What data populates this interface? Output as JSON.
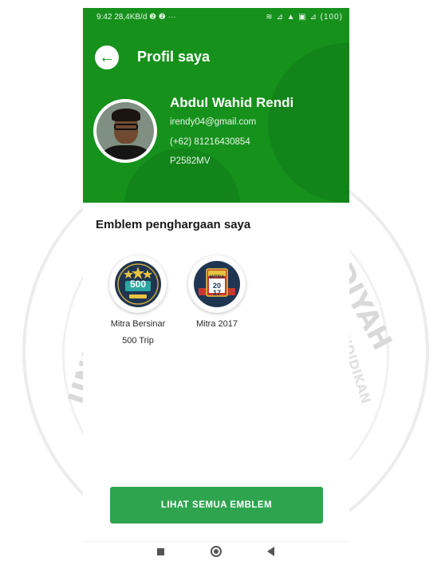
{
  "status_bar": {
    "left": "9:42  28,4KB/d ❷ ❷ ···",
    "right": "≋ ⊿ ▲ ▣ ⊿ (100)"
  },
  "header": {
    "title": "Profil saya",
    "back_icon": "arrow-left-icon"
  },
  "profile": {
    "name": "Abdul Wahid Rendi",
    "email": "irendy04@gmail.com",
    "phone": "(+62) 81216430854",
    "code": "P2582MV"
  },
  "emblems": {
    "title": "Emblem penghargaan saya",
    "items": [
      {
        "label_line1": "Mitra Bersinar",
        "label_line2": "500 Trip",
        "badge_text": "500",
        "icon": "stars-500-badge-icon"
      },
      {
        "label_line1": "Mitra 2017",
        "label_line2": "",
        "badge_top": "MITRA",
        "badge_num_top": "20",
        "badge_num_bottom": "17",
        "icon": "mitra-2017-badge-icon"
      }
    ]
  },
  "cta": {
    "label": "LIHAT SEMUA EMBLEM"
  },
  "watermark": {
    "letters_right": "ADIYAH",
    "letters_left": "UNIV",
    "small_text": "PENDIDIKAN"
  },
  "colors": {
    "header_green": "#16911c",
    "button_green": "#2ea44f",
    "badge_navy": "#1f3551",
    "badge_red": "#c43a2c"
  }
}
